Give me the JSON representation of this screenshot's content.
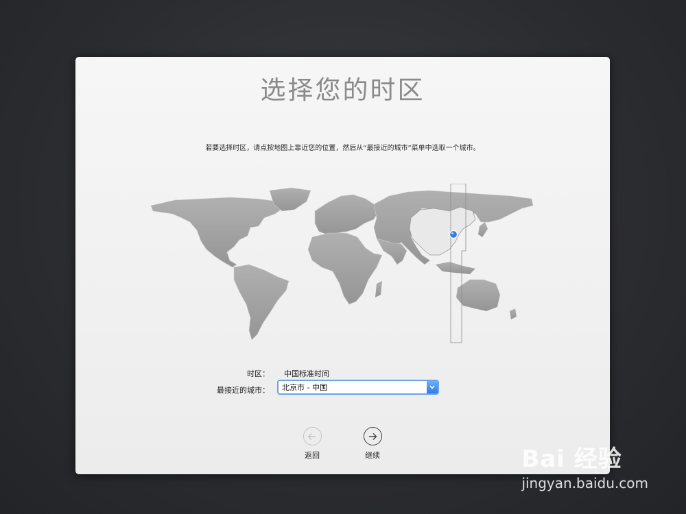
{
  "window": {
    "title": "选择您的时区",
    "instruction": "若要选择时区，请点按地图上靠近您的位置，然后从“最接近的城市”菜单中选取一个城市。"
  },
  "map": {
    "selected_region": "China",
    "highlight_color": "#e8e8e8",
    "land_color": "#a3a3a3",
    "pin_color": "#2f7be8"
  },
  "form": {
    "timezone_label": "时区：",
    "timezone_value": "中国标准时间",
    "city_label": "最接近的城市：",
    "city_value": "北京市 - 中国"
  },
  "nav": {
    "back_label": "返回",
    "continue_label": "继续",
    "back_icon": "arrow-left-icon",
    "continue_icon": "arrow-right-icon"
  },
  "watermark": {
    "brand": "Bai 经验",
    "url": "jingyan.baidu.com"
  }
}
